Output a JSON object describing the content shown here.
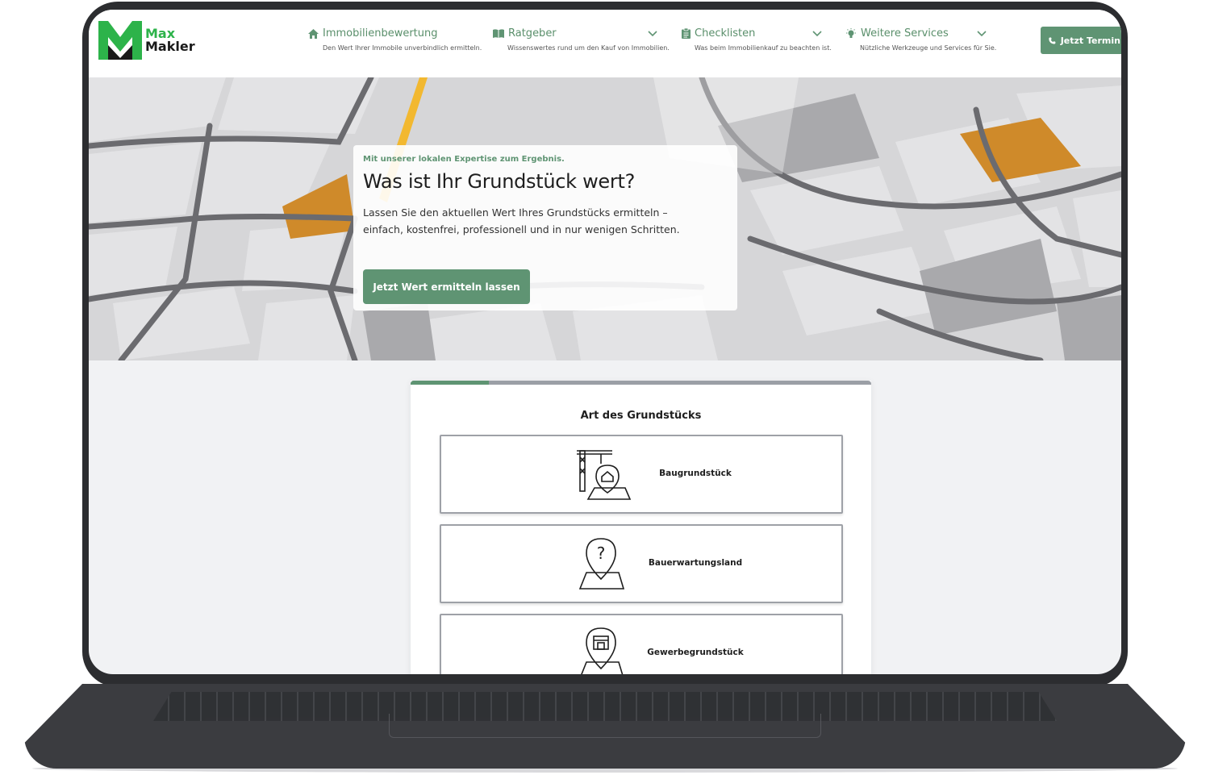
{
  "brand": {
    "line1": "Max",
    "line2": "Makler",
    "color_green": "#2db34a",
    "color_dark": "#1a1a1a"
  },
  "nav": [
    {
      "title": "Immobilienbewertung",
      "subtitle": "Den Wert Ihrer Immobile unverbindlich ermitteln.",
      "icon": "home-icon",
      "has_dropdown": false
    },
    {
      "title": "Ratgeber",
      "subtitle": "Wissenswertes rund um den Kauf von Immobilien.",
      "icon": "book-icon",
      "has_dropdown": true
    },
    {
      "title": "Checklisten",
      "subtitle": "Was beim Immobilienkauf zu beachten ist.",
      "icon": "clipboard-icon",
      "has_dropdown": true
    },
    {
      "title": "Weitere Services",
      "subtitle": "Nützliche Werkzeuge und Services für Sie.",
      "icon": "lightbulb-icon",
      "has_dropdown": true
    }
  ],
  "cta": {
    "label": "Jetzt Termin v",
    "icon": "phone-icon"
  },
  "hero": {
    "kicker": "Mit unserer lokalen Expertise zum Ergebnis.",
    "title": "Was ist Ihr Grundstück wert?",
    "text": "Lassen Sie den aktuellen Wert Ihres Grundstücks ermitteln – einfach, kostenfrei, professionell und in nur wenigen Schritten.",
    "button": "Jetzt Wert ermitteln lassen"
  },
  "form": {
    "progress_fraction": 0.17,
    "title": "Art des Grundstücks",
    "options": [
      {
        "label": "Baugrundstück",
        "icon": "construction-plot-icon"
      },
      {
        "label": "Bauerwartungsland",
        "icon": "question-pin-icon"
      },
      {
        "label": "Gewerbegrundstück",
        "icon": "shop-pin-icon"
      }
    ]
  },
  "colors": {
    "accent": "#5f9473",
    "frame": "#2c2d30",
    "page_bg": "#f1f2f4"
  }
}
